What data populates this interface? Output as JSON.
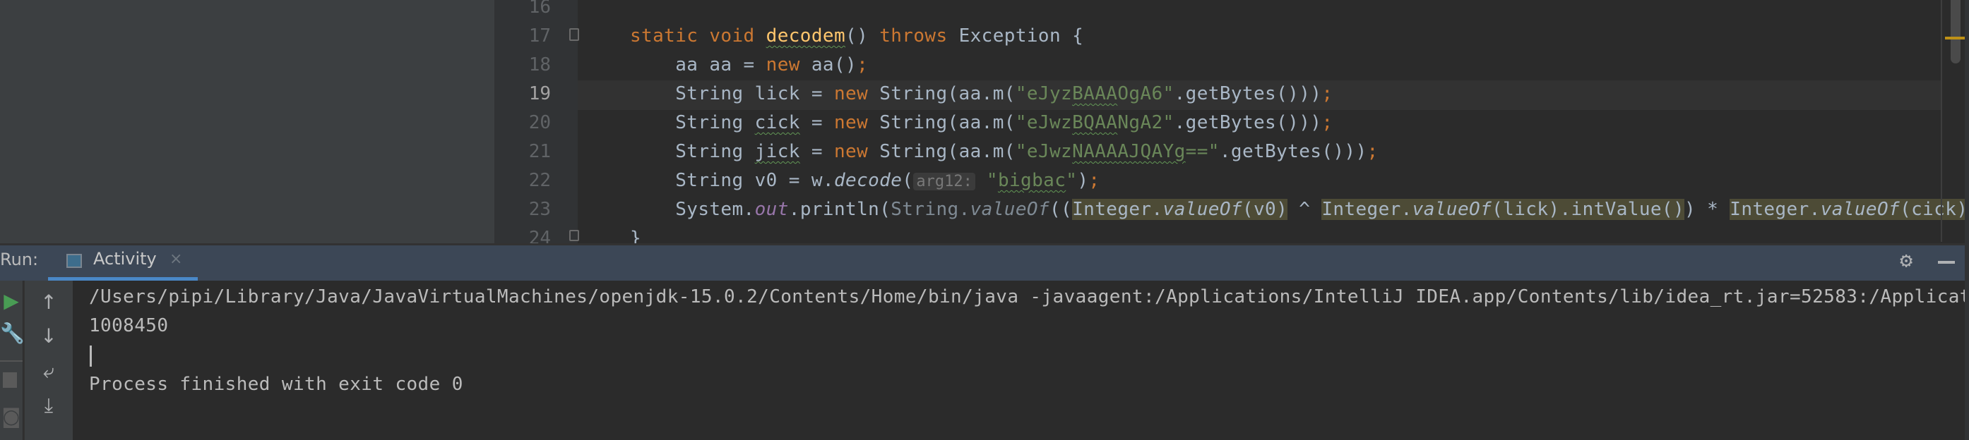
{
  "editor": {
    "line_numbers": [
      "16",
      "17",
      "18",
      "19",
      "20",
      "21",
      "22",
      "23",
      "24"
    ],
    "current_line": "19",
    "lines": [
      [],
      [
        {
          "t": "static void ",
          "c": "kw"
        },
        {
          "t": "decodem",
          "c": "fn wav"
        },
        {
          "t": "() ",
          "c": ""
        },
        {
          "t": "throws ",
          "c": "kw"
        },
        {
          "t": "Exception {",
          "c": ""
        }
      ],
      [
        {
          "t": "    aa aa = ",
          "c": ""
        },
        {
          "t": "new ",
          "c": "kw"
        },
        {
          "t": "aa()",
          "c": ""
        },
        {
          "t": ";",
          "c": "kw"
        }
      ],
      [
        {
          "t": "    String lick = ",
          "c": ""
        },
        {
          "t": "new ",
          "c": "kw"
        },
        {
          "t": "String(aa.m(",
          "c": ""
        },
        {
          "t": "\"eJyz",
          "c": "str"
        },
        {
          "t": "BAAA",
          "c": "str wav"
        },
        {
          "t": "OgA6\"",
          "c": "str"
        },
        {
          "t": ".getBytes()))",
          "c": ""
        },
        {
          "t": ";",
          "c": "kw"
        }
      ],
      [
        {
          "t": "    String ",
          "c": ""
        },
        {
          "t": "cick",
          "c": "wav"
        },
        {
          "t": " = ",
          "c": ""
        },
        {
          "t": "new ",
          "c": "kw"
        },
        {
          "t": "String(aa.m(",
          "c": ""
        },
        {
          "t": "\"eJwz",
          "c": "str"
        },
        {
          "t": "BQAA",
          "c": "str wav"
        },
        {
          "t": "NgA2\"",
          "c": "str"
        },
        {
          "t": ".getBytes()))",
          "c": ""
        },
        {
          "t": ";",
          "c": "kw"
        }
      ],
      [
        {
          "t": "    String ",
          "c": ""
        },
        {
          "t": "jick",
          "c": "wav"
        },
        {
          "t": " = ",
          "c": ""
        },
        {
          "t": "new ",
          "c": "kw"
        },
        {
          "t": "String(aa.m(",
          "c": ""
        },
        {
          "t": "\"eJwz",
          "c": "str"
        },
        {
          "t": "NAAAAJQAYg",
          "c": "str wav"
        },
        {
          "t": "==\"",
          "c": "str"
        },
        {
          "t": ".getBytes()))",
          "c": ""
        },
        {
          "t": ";",
          "c": "kw"
        }
      ],
      [
        {
          "t": "    String v0 = w.",
          "c": ""
        },
        {
          "t": "decode",
          "c": "it"
        },
        {
          "t": "(",
          "c": ""
        },
        {
          "t": "arg12:",
          "c": "hint"
        },
        {
          "t": " \"",
          "c": "str"
        },
        {
          "t": "bigbac",
          "c": "str wav"
        },
        {
          "t": "\"",
          "c": "str"
        },
        {
          "t": ")",
          "c": ""
        },
        {
          "t": ";",
          "c": "kw"
        }
      ],
      [
        {
          "t": "    System.",
          "c": ""
        },
        {
          "t": "out",
          "c": "fld"
        },
        {
          "t": ".println(",
          "c": ""
        },
        {
          "t": "String.",
          "c": "dim"
        },
        {
          "t": "valueOf",
          "c": "dim it"
        },
        {
          "t": "((",
          "c": ""
        },
        {
          "t": "Integer.",
          "c": "hl"
        },
        {
          "t": "valueOf",
          "c": "hl it"
        },
        {
          "t": "(v0)",
          "c": "hl"
        },
        {
          "t": " ^ ",
          "c": ""
        },
        {
          "t": "Integer.",
          "c": "hl"
        },
        {
          "t": "valueOf",
          "c": "hl it"
        },
        {
          "t": "(lick).intValue()",
          "c": "hl"
        },
        {
          "t": ") * ",
          "c": ""
        },
        {
          "t": "Integer.",
          "c": "hl"
        },
        {
          "t": "valueOf",
          "c": "hl it"
        },
        {
          "t": "(cick)",
          "c": "hl"
        }
      ],
      [
        {
          "t": "}",
          "c": ""
        }
      ]
    ]
  },
  "run_panel": {
    "label": "Run:",
    "tab_label": "Activity",
    "tab_close": "×",
    "console_lines": [
      "/Users/pipi/Library/Java/JavaVirtualMachines/openjdk-15.0.2/Contents/Home/bin/java -javaagent:/Applications/IntelliJ IDEA.app/Contents/lib/idea_rt.jar=52583:/Applicat",
      "1008450",
      "",
      "Process finished with exit code 0"
    ]
  },
  "colors": {
    "keyword": "#cc7832",
    "string": "#6a8759",
    "function": "#ffc66d",
    "accent": "#4a88c7",
    "run_green": "#499c54"
  }
}
